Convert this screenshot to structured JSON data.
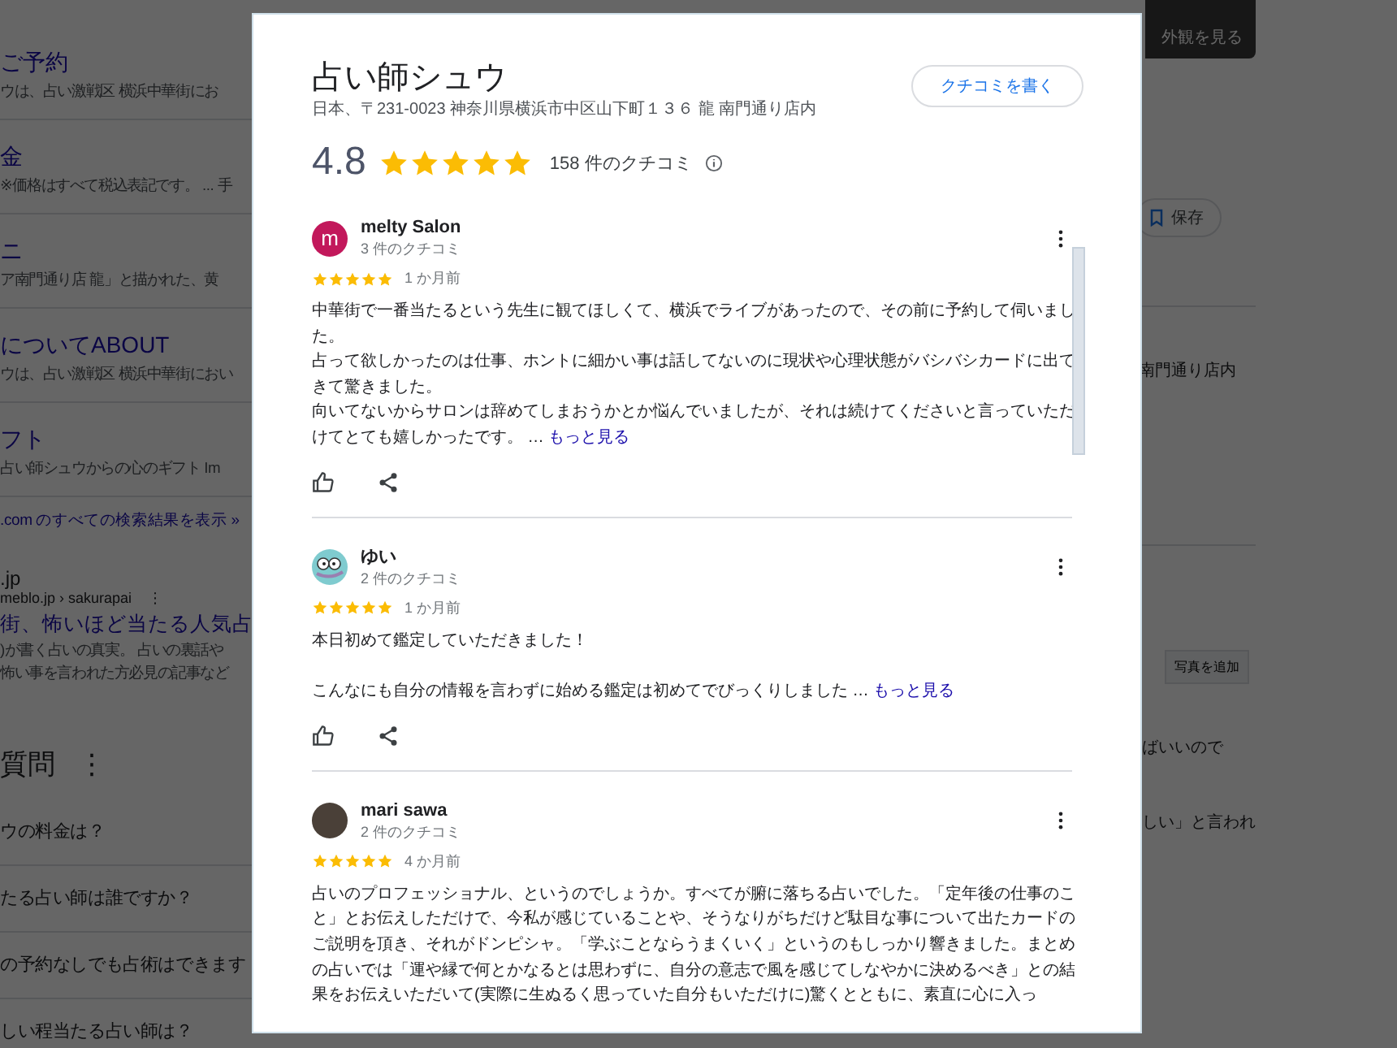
{
  "background": {
    "left": {
      "results": [
        {
          "title": "ご予約",
          "snippet": "ウは、占い激戦区 横浜中華街にお"
        },
        {
          "title": "金",
          "snippet": "※価格はすべて税込表記です。 ... 手"
        },
        {
          "title": "ニ",
          "snippet": "ア南門通り店 龍」と描かれた、黄"
        },
        {
          "title": "についてABOUT",
          "snippet": "ウは、占い激戦区 横浜中華街におい"
        },
        {
          "title": "フト",
          "snippet": "占い師シュウからの心のギフト Im"
        }
      ],
      "more_link": ".com のすべての検索結果を表示 »",
      "result": {
        "site": ".jp",
        "url": "meblo.jp › sakurapai",
        "menu": "⋮",
        "title": "街、怖いほど当たる人気占",
        "snippet_lines": [
          ")が書く占いの真実。 占いの裏話や",
          "怖い事を言われた方必見の記事など"
        ]
      },
      "faq": {
        "heading": "質問",
        "menu": "⋮",
        "questions": [
          "ウの料金は？",
          "たる占い師は誰ですか？",
          "の予約なしでも占術はできます",
          "しい程当たる占い師は？"
        ]
      }
    },
    "right": {
      "photo_label": "外観を見る",
      "save_button": "保存",
      "address_tail": "南門通り店内",
      "add_photo_button": "写真を追加",
      "snippets": [
        "ばいいので",
        "しい」と言われ"
      ]
    }
  },
  "dialog": {
    "title": "占い師シュウ",
    "address": "日本、〒231-0023 神奈川県横浜市中区山下町１３６ 龍 南門通り店内",
    "write_review_button": "クチコミを書く",
    "rating": {
      "value": "4.8",
      "stars": 5,
      "count": "158 件のクチコミ"
    },
    "reviews": [
      {
        "name": "melty Salon",
        "count": "3 件のクチコミ",
        "avatar": {
          "kind": "letter",
          "letter": "m",
          "color": "#c2185b"
        },
        "stars": 5,
        "time": "1 か月前",
        "paragraph_gap": false,
        "paragraphs": [
          "中華街で一番当たるという先生に観てほしくて、横浜でライブがあったので、その前に予約して伺いました。",
          "占って欲しかったのは仕事、ホントに細かい事は話してないのに現状や心理状態がバシバシカードに出てきて驚きました。",
          "向いてないからサロンは辞めてしまおうかとか悩んでいましたが、それは続けてくださいと言っていただけてとても嬉しかったです。 …"
        ],
        "more": "もっと見る"
      },
      {
        "name": "ゆい",
        "count": "2 件のクチコミ",
        "avatar": {
          "kind": "cartoon"
        },
        "stars": 5,
        "time": "1 か月前",
        "paragraph_gap": true,
        "paragraphs": [
          "本日初めて鑑定していただきました！",
          "こんなにも自分の情報を言わずに始める鑑定は初めてでびっくりしました …"
        ],
        "more": "もっと見る"
      },
      {
        "name": "mari sawa",
        "count": "2 件のクチコミ",
        "avatar": {
          "kind": "photo"
        },
        "stars": 5,
        "time": "4 か月前",
        "paragraph_gap": false,
        "paragraphs": [
          "占いのプロフェッショナル、というのでしょうか。すべてが腑に落ちる占いでした。「定年後の仕事のこと」とお伝えしただけで、今私が感じていることや、そうなりがちだけど駄目な事について出たカードのご説明を頂き、それがドンピシャ。「学ぶことならうまくいく」というのもしっかり響きました。まとめの占いでは「運や縁で何とかなるとは思わずに、自分の意志で風を感じてしなやかに決めるべき」との結果をお伝えいただいて(実際に生ぬるく思っていた自分もいただけに)驚くとともに、素直に心に入っ"
        ]
      }
    ]
  }
}
